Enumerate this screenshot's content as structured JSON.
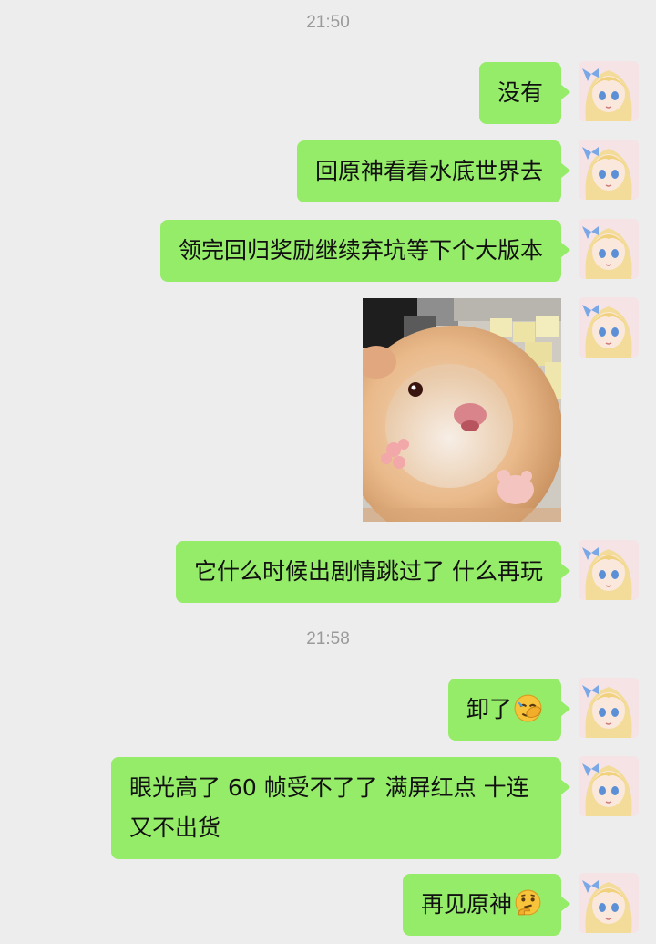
{
  "chat": {
    "timestamps": [
      "21:50",
      "21:58"
    ],
    "messages": [
      {
        "type": "text",
        "text": "没有"
      },
      {
        "type": "text",
        "text": "回原神看看水底世界去"
      },
      {
        "type": "text",
        "text": "领完回归奖励继续弃坑等下个大版本"
      },
      {
        "type": "image",
        "icon": "hamster-sticker"
      },
      {
        "type": "text",
        "text": "它什么时候出剧情跳过了 什么再玩"
      },
      {
        "type": "text",
        "text": "卸了",
        "emoji": "face-palm-emoji"
      },
      {
        "type": "text",
        "text": "眼光高了 60 帧受不了了 满屏红点 十连又不出货"
      },
      {
        "type": "text",
        "text": "再见原神",
        "emoji": "thinking-face-emoji"
      }
    ]
  },
  "theme": {
    "background": "#ededed",
    "bubble_color": "#95ec69",
    "timestamp_color": "#9a9a9a",
    "text_color": "#111111"
  }
}
